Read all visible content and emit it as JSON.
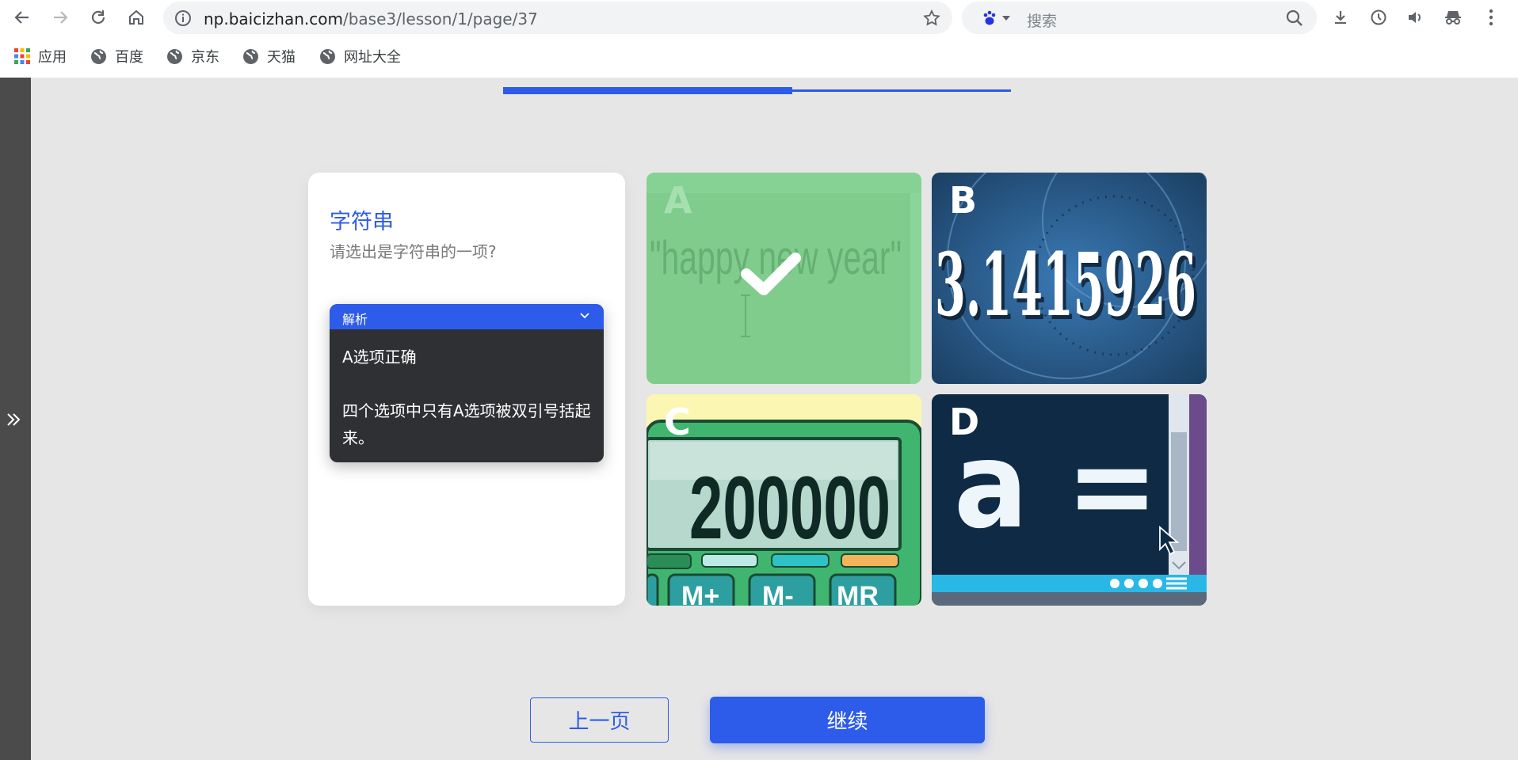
{
  "browser": {
    "url_host": "np.baicizhan.com",
    "url_path": "/base3/lesson/1/page/37",
    "search_placeholder": "搜索",
    "bookmarks": [
      "应用",
      "百度",
      "京东",
      "天猫",
      "网址大全"
    ]
  },
  "lesson": {
    "progress": 0.57,
    "accent_color": "#2d5bea",
    "title": "字符串",
    "question": "请选出是字符串的一项?",
    "analysis": {
      "header": "解析",
      "line1": "A选项正确",
      "line2": "四个选项中只有A选项被双引号括起来。"
    },
    "options": [
      {
        "letter": "A",
        "text": "\"happy new year\"",
        "state": "correct"
      },
      {
        "letter": "B",
        "text": "3.1415926",
        "state": "normal"
      },
      {
        "letter": "C",
        "text": "200000",
        "keys": [
          "M+",
          "M-",
          "MR"
        ],
        "state": "normal"
      },
      {
        "letter": "D",
        "text": "a =",
        "state": "normal"
      }
    ],
    "prev_label": "上一页",
    "next_label": "继续"
  }
}
